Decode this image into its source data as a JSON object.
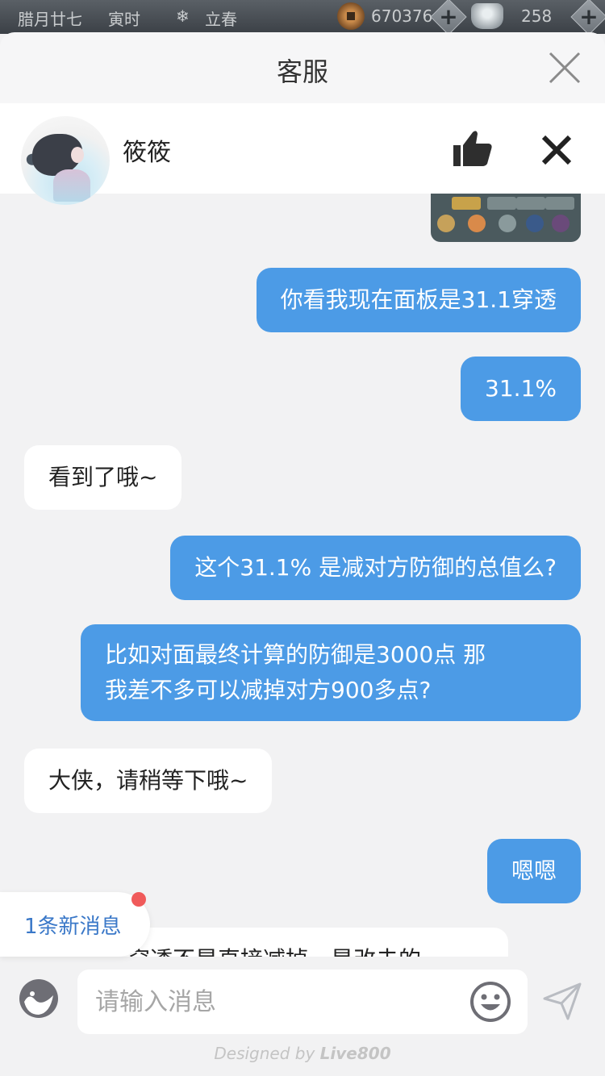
{
  "status_bar": {
    "lunar_date": "腊月廿七",
    "shichen": "寅时",
    "solar_term": "立春",
    "coins": "670376",
    "silver": "258"
  },
  "header": {
    "title": "客服"
  },
  "agent": {
    "name": "筱筱"
  },
  "messages": [
    {
      "side": "out",
      "text": "你看我现在面板是31.1穿透"
    },
    {
      "side": "out",
      "text": "31.1%"
    },
    {
      "side": "in",
      "text": "看到了哦~"
    },
    {
      "side": "out",
      "text": "这个31.1% 是减对方防御的总值么?"
    },
    {
      "side": "out",
      "line1": "比如对面最终计算的防御是3000点 那",
      "line2": "我差不多可以减掉对方900多点?"
    },
    {
      "side": "in",
      "text": "大侠，请稍等下哦~"
    },
    {
      "side": "out",
      "text": "嗯嗯"
    },
    {
      "side": "in",
      "text": "穿透不是直接减掉，是改击的"
    }
  ],
  "new_message_badge": "1条新消息",
  "input": {
    "placeholder": "请输入消息"
  },
  "footer": {
    "prefix": "Designed by",
    "brand": "Live800"
  },
  "colors": {
    "outgoing_bubble": "#4c9be6",
    "incoming_bubble": "#ffffff",
    "accent_link": "#3a78c8",
    "badge_dot": "#f05a5a"
  }
}
